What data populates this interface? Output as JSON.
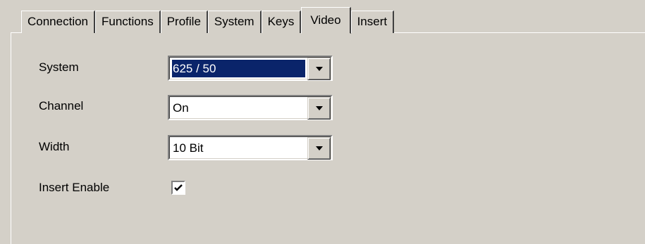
{
  "tabs": [
    {
      "label": "Connection"
    },
    {
      "label": "Functions"
    },
    {
      "label": "Profile"
    },
    {
      "label": "System"
    },
    {
      "label": "Keys"
    },
    {
      "label": "Video"
    },
    {
      "label": "Insert"
    }
  ],
  "active_tab": "Video",
  "fields": {
    "system": {
      "label": "System",
      "value": "625 / 50"
    },
    "channel": {
      "label": "Channel",
      "value": "On"
    },
    "width": {
      "label": "Width",
      "value": "10 Bit"
    },
    "insert_enable": {
      "label": "Insert Enable",
      "checked": true
    }
  },
  "icons": {
    "dropdown": "chevron-down-icon",
    "check": "checkmark-icon"
  },
  "colors": {
    "background": "#d4d0c8",
    "selection": "#0a246a"
  }
}
